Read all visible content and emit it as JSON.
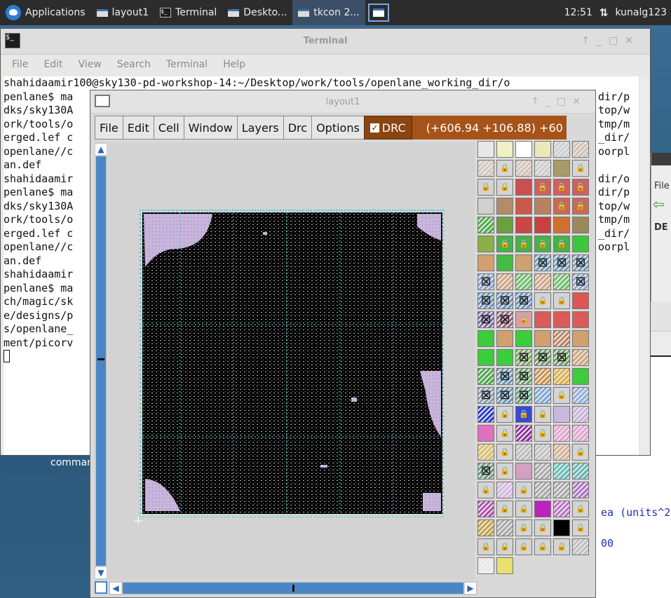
{
  "taskbar": {
    "items": [
      {
        "label": "Applications"
      },
      {
        "label": "layout1"
      },
      {
        "label": "Terminal"
      },
      {
        "label": "Deskto..."
      },
      {
        "label": "tkcon 2..."
      }
    ],
    "clock": "12:51",
    "user": "kunalg123"
  },
  "desktop": {
    "icon_label": "command"
  },
  "terminal": {
    "title": "Terminal",
    "menu": [
      "File",
      "Edit",
      "View",
      "Search",
      "Terminal",
      "Help"
    ],
    "lines": [
      "shahidaamir100@sky130-pd-workshop-14:~/Desktop/work/tools/openlane_working_dir/o",
      "penlane$ ma",
      "dks/sky130A",
      "ork/tools/o",
      "erged.lef c",
      "openlane//c",
      "an.def",
      "shahidaamir",
      "penlane$ ma",
      "dks/sky130A",
      "ork/tools/o",
      "erged.lef c",
      "openlane//c",
      "an.def",
      "shahidaamir",
      "penlane$ ma",
      "ch/magic/sk",
      "e/designs/p",
      "s/openlane_",
      "ment/picorv"
    ],
    "right_fragments": [
      "dir/p",
      "top/w",
      "tmp/m",
      "_dir/",
      "oorpl",
      "",
      "dir/o",
      "dir/p",
      "top/w",
      "tmp/m",
      "_dir/",
      "oorpl"
    ]
  },
  "side_window": {
    "menu_fragment": "File",
    "label_fragment": "DE"
  },
  "tkcon_fragment": {
    "line1": "ea (units^2",
    "line2": "00"
  },
  "layout": {
    "title": "layout1",
    "menu": [
      "File",
      "Edit",
      "Cell",
      "Window",
      "Layers",
      "Drc",
      "Options"
    ],
    "drc_label": "DRC",
    "drc_checked": true,
    "coordinates": "(+606.94 +106.88) +60",
    "palette": [
      {
        "icon": "grid-swatch",
        "color": "#e8e8e8",
        "lock": false
      },
      {
        "icon": "yellow-outline",
        "color": "#f0f0c0",
        "lock": false
      },
      {
        "icon": "black-outline",
        "color": "#ffffff",
        "lock": false
      },
      {
        "icon": "yellow-hatch",
        "color": "#ecec9a",
        "lock": false
      },
      {
        "icon": "dark-hatch",
        "color": "#cfcfcf",
        "lock": false
      },
      {
        "icon": "brown-hatch",
        "color": "#d6c0b0",
        "lock": false
      },
      {
        "icon": "brown-hatch",
        "color": "#d8c6b8",
        "lock": false
      },
      {
        "icon": "lock",
        "color": "#d6d6d6",
        "lock": true
      },
      {
        "icon": "brown-hatch",
        "color": "#d6c4b6",
        "lock": false
      },
      {
        "icon": "dark-hatch",
        "color": "#cccccc",
        "lock": false
      },
      {
        "icon": "olive",
        "color": "#a89a6a",
        "lock": false
      },
      {
        "icon": "lock",
        "color": "#d6d6d6",
        "lock": true
      },
      {
        "icon": "lock",
        "color": "#d4d4d4",
        "lock": true
      },
      {
        "icon": "lock",
        "color": "#d4d4d4",
        "lock": true
      },
      {
        "icon": "red",
        "color": "#c95050",
        "lock": false
      },
      {
        "icon": "lock",
        "color": "#d06060",
        "lock": true
      },
      {
        "icon": "lock",
        "color": "#d06060",
        "lock": true
      },
      {
        "icon": "lock",
        "color": "#d06060",
        "lock": true
      },
      {
        "icon": "gray",
        "color": "#d0d0d0",
        "lock": false
      },
      {
        "icon": "brown",
        "color": "#b58a66",
        "lock": false
      },
      {
        "icon": "red",
        "color": "#c85a4a",
        "lock": false
      },
      {
        "icon": "brown",
        "color": "#b88260",
        "lock": false
      },
      {
        "icon": "lock",
        "color": "#c86a5a",
        "lock": true
      },
      {
        "icon": "lock",
        "color": "#c86a5a",
        "lock": true
      },
      {
        "icon": "green-dots",
        "color": "#46b046",
        "lock": false
      },
      {
        "icon": "green",
        "color": "#6aa040",
        "lock": false
      },
      {
        "icon": "red",
        "color": "#c84848",
        "lock": false
      },
      {
        "icon": "red",
        "color": "#c84040",
        "lock": false
      },
      {
        "icon": "orange",
        "color": "#d07030",
        "lock": false
      },
      {
        "icon": "olive",
        "color": "#9a8a5a",
        "lock": false
      },
      {
        "icon": "green-orange",
        "color": "#8ab04a",
        "lock": false
      },
      {
        "icon": "lock",
        "color": "#4ab04a",
        "lock": true
      },
      {
        "icon": "lock",
        "color": "#4ab04a",
        "lock": true
      },
      {
        "icon": "lock",
        "color": "#4ab04a",
        "lock": true
      },
      {
        "icon": "lock",
        "color": "#4ab04a",
        "lock": true
      },
      {
        "icon": "green",
        "color": "#3cc83c",
        "lock": false
      },
      {
        "icon": "tan",
        "color": "#d2a070",
        "lock": false
      },
      {
        "icon": "green",
        "color": "#44bb44",
        "lock": false
      },
      {
        "icon": "tan",
        "color": "#cfa070",
        "lock": false
      },
      {
        "icon": "cross",
        "color": "#6f9ec0",
        "lock": false
      },
      {
        "icon": "cross",
        "color": "#6f9ec0",
        "lock": false
      },
      {
        "icon": "cross",
        "color": "#6f9ec0",
        "lock": false
      },
      {
        "icon": "cross",
        "color": "#8aa6d0",
        "lock": false
      },
      {
        "icon": "tan-dots",
        "color": "#d6a480",
        "lock": false
      },
      {
        "icon": "green-dots",
        "color": "#6ac06a",
        "lock": false
      },
      {
        "icon": "tan-dots",
        "color": "#d6a480",
        "lock": false
      },
      {
        "icon": "green-dots",
        "color": "#6ac06a",
        "lock": false
      },
      {
        "icon": "cross",
        "color": "#8aa6d0",
        "lock": false
      },
      {
        "icon": "cross",
        "color": "#6a96c0",
        "lock": false
      },
      {
        "icon": "cross",
        "color": "#6a96c0",
        "lock": false
      },
      {
        "icon": "cross",
        "color": "#6a96c0",
        "lock": false
      },
      {
        "icon": "lock",
        "color": "#d4d4d4",
        "lock": true
      },
      {
        "icon": "lock",
        "color": "#d4d4d4",
        "lock": true
      },
      {
        "icon": "red",
        "color": "#dd5555",
        "lock": false
      },
      {
        "icon": "cross",
        "color": "#7c6aa8",
        "lock": false
      },
      {
        "icon": "cross",
        "color": "#a06080",
        "lock": false
      },
      {
        "icon": "lock",
        "color": "#d8a0a0",
        "lock": true
      },
      {
        "icon": "red",
        "color": "#dd5a5a",
        "lock": false
      },
      {
        "icon": "red",
        "color": "#dd5a5a",
        "lock": false
      },
      {
        "icon": "red",
        "color": "#dd5a5a",
        "lock": false
      },
      {
        "icon": "green",
        "color": "#3ccc3c",
        "lock": false
      },
      {
        "icon": "tan",
        "color": "#d0a070",
        "lock": false
      },
      {
        "icon": "green",
        "color": "#3ccc3c",
        "lock": false
      },
      {
        "icon": "tan",
        "color": "#d0a070",
        "lock": false
      },
      {
        "icon": "brown-hatch",
        "color": "#c08060",
        "lock": false
      },
      {
        "icon": "tan",
        "color": "#cfa070",
        "lock": false
      },
      {
        "icon": "green",
        "color": "#3ccc3c",
        "lock": false
      },
      {
        "icon": "green",
        "color": "#3ccc3c",
        "lock": false
      },
      {
        "icon": "cross",
        "color": "#7aa860",
        "lock": false
      },
      {
        "icon": "cross",
        "color": "#6a9e60",
        "lock": false
      },
      {
        "icon": "cross",
        "color": "#6a9e60",
        "lock": false
      },
      {
        "icon": "tan-hatch",
        "color": "#d4a274",
        "lock": false
      },
      {
        "icon": "green-hatch",
        "color": "#4aa84a",
        "lock": false
      },
      {
        "icon": "cross",
        "color": "#6a96c0",
        "lock": false
      },
      {
        "icon": "cross",
        "color": "#6aa070",
        "lock": false
      },
      {
        "icon": "orange-hatch",
        "color": "#d09040",
        "lock": false
      },
      {
        "icon": "orange-hatch",
        "color": "#e0b040",
        "lock": false
      },
      {
        "icon": "green",
        "color": "#3ccc3c",
        "lock": false
      },
      {
        "icon": "cross",
        "color": "#8aa0b8",
        "lock": false
      },
      {
        "icon": "cross",
        "color": "#6a96c0",
        "lock": false
      },
      {
        "icon": "cross",
        "color": "#60a080",
        "lock": false
      },
      {
        "icon": "blue-lines",
        "color": "#7aa8e0",
        "lock": false
      },
      {
        "icon": "lock",
        "color": "#d4d4d4",
        "lock": true
      },
      {
        "icon": "blue-lines",
        "color": "#8ab0e0",
        "lock": false
      },
      {
        "icon": "blue-pattern",
        "color": "#2a3ad0",
        "lock": false
      },
      {
        "icon": "lock",
        "color": "#d4d4d4",
        "lock": true
      },
      {
        "icon": "lock",
        "color": "#3a4ad0",
        "lock": true
      },
      {
        "icon": "lock",
        "color": "#d4d4d4",
        "lock": true
      },
      {
        "icon": "lavender",
        "color": "#c8b8e0",
        "lock": false
      },
      {
        "icon": "lavender-hatch",
        "color": "#c8b0d8",
        "lock": false
      },
      {
        "icon": "pink",
        "color": "#e070c0",
        "lock": false
      },
      {
        "icon": "lock",
        "color": "#d4d4d4",
        "lock": true
      },
      {
        "icon": "purple-lines",
        "color": "#9030a0",
        "lock": false
      },
      {
        "icon": "lock",
        "color": "#d4d4d4",
        "lock": true
      },
      {
        "icon": "pink-pattern",
        "color": "#e8a0d0",
        "lock": false
      },
      {
        "icon": "pink-pattern",
        "color": "#e8a0d0",
        "lock": false
      },
      {
        "icon": "yellow-pattern",
        "color": "#e0c060",
        "lock": false
      },
      {
        "icon": "lock",
        "color": "#d4d4d4",
        "lock": true
      },
      {
        "icon": "gray-pattern",
        "color": "#bcbcbc",
        "lock": false
      },
      {
        "icon": "gray-pattern",
        "color": "#c0c0c0",
        "lock": false
      },
      {
        "icon": "tan-hatch",
        "color": "#d4b290",
        "lock": false
      },
      {
        "icon": "lock",
        "color": "#d4d4d4",
        "lock": true
      },
      {
        "icon": "cross",
        "color": "#6a9e80",
        "lock": false
      },
      {
        "icon": "lock",
        "color": "#d4d4d4",
        "lock": true
      },
      {
        "icon": "pink",
        "color": "#d4a0c0",
        "lock": false
      },
      {
        "icon": "dark-hatch",
        "color": "#aaaaaa",
        "lock": false
      },
      {
        "icon": "teal-hatch",
        "color": "#60c0b8",
        "lock": false
      },
      {
        "icon": "teal-hatch",
        "color": "#60b8b0",
        "lock": false
      },
      {
        "icon": "lock",
        "color": "#d4d4d4",
        "lock": true
      },
      {
        "icon": "purple-dots",
        "color": "#d8b8e8",
        "lock": false
      },
      {
        "icon": "lock",
        "color": "#d4d4d4",
        "lock": true
      },
      {
        "icon": "dark-hatch",
        "color": "#a8a8a8",
        "lock": false
      },
      {
        "icon": "dark-hatch",
        "color": "#a8a8a8",
        "lock": false
      },
      {
        "icon": "purple-hatch",
        "color": "#b070c8",
        "lock": false
      },
      {
        "icon": "purple-hatch",
        "color": "#b050b0",
        "lock": false
      },
      {
        "icon": "lock",
        "color": "#d4d4d4",
        "lock": true
      },
      {
        "icon": "lock",
        "color": "#d4d4d4",
        "lock": true
      },
      {
        "icon": "magenta",
        "color": "#c020c0",
        "lock": false
      },
      {
        "icon": "purple-hatch",
        "color": "#c070c8",
        "lock": false
      },
      {
        "icon": "lock",
        "color": "#d4d4d4",
        "lock": true
      },
      {
        "icon": "yellow-pattern",
        "color": "#c8a040",
        "lock": false
      },
      {
        "icon": "gray-lines",
        "color": "#a8a8a8",
        "lock": false
      },
      {
        "icon": "lock",
        "color": "#d4d4d4",
        "lock": true
      },
      {
        "icon": "lock",
        "color": "#d4d4d4",
        "lock": true
      },
      {
        "icon": "black",
        "color": "#000000",
        "lock": false
      },
      {
        "icon": "lock",
        "color": "#d4d4d4",
        "lock": true
      },
      {
        "icon": "lock",
        "color": "#d4d4d4",
        "lock": true
      },
      {
        "icon": "lock",
        "color": "#d4d4d4",
        "lock": true
      },
      {
        "icon": "lock",
        "color": "#d4d4d4",
        "lock": true
      },
      {
        "icon": "lock",
        "color": "#d4d4d4",
        "lock": true
      },
      {
        "icon": "lock",
        "color": "#d4d4d4",
        "lock": true
      },
      {
        "icon": "dark-hatch",
        "color": "#c0c0c0",
        "lock": false
      },
      {
        "icon": "white-dots",
        "color": "#f0f0f0",
        "lock": false
      },
      {
        "icon": "yellow",
        "color": "#e8e070",
        "lock": false
      }
    ]
  }
}
